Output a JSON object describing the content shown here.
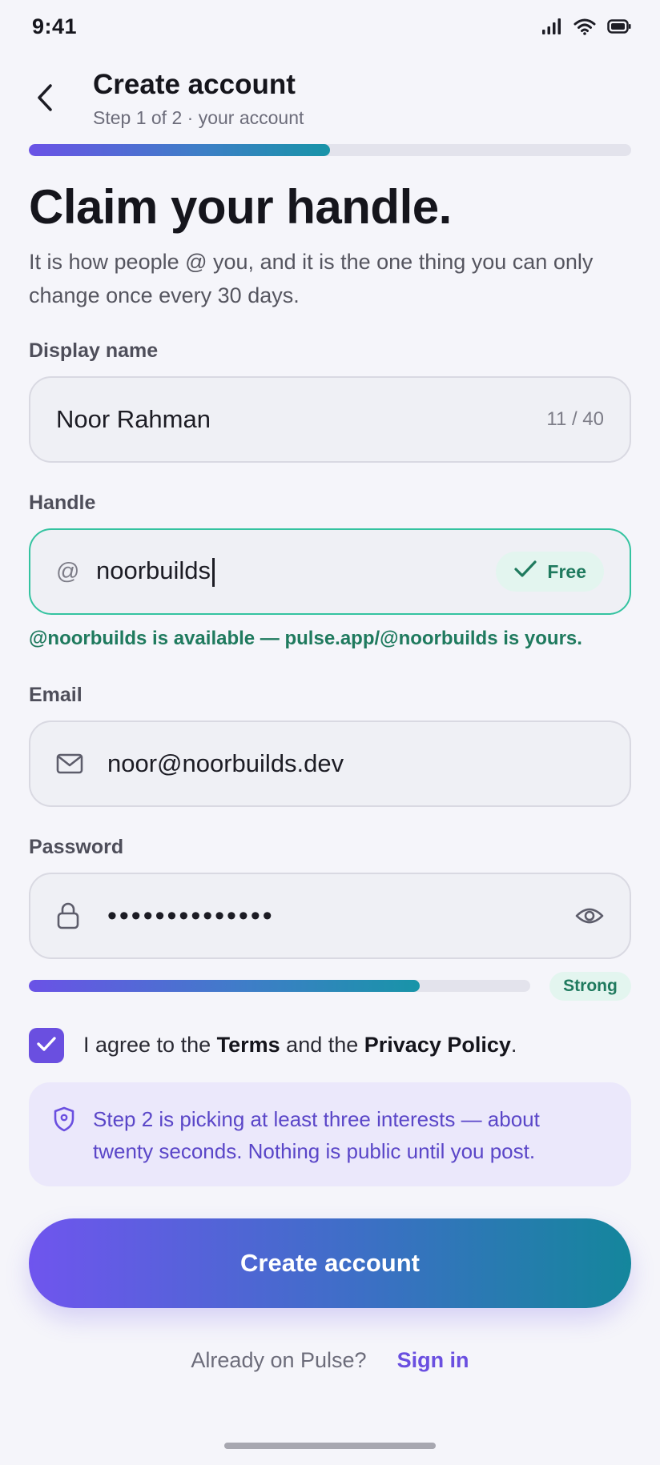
{
  "status_bar": {
    "time": "9:41"
  },
  "header": {
    "title": "Create account",
    "subtitle": "Step 1 of 2 · your account",
    "progress": 0.5
  },
  "headline": "Claim your handle.",
  "intro": "It is how people @ you, and it is the one thing you can only change once every 30 days.",
  "display_name": {
    "label": "Display name",
    "value": "Noor Rahman",
    "counter": "11 / 40"
  },
  "handle": {
    "label": "Handle",
    "prefix": "@",
    "value": "noorbuilds",
    "status": "Free",
    "message": "@noorbuilds is available — pulse.app/@noorbuilds is yours."
  },
  "email": {
    "label": "Email",
    "value": "noor@noorbuilds.dev"
  },
  "password": {
    "label": "Password",
    "masked": "••••••••••••••",
    "strength_label": "Strong",
    "strength": 0.78
  },
  "agreement": {
    "checked": true,
    "prefix": "I agree to the ",
    "terms": "Terms",
    "middle": " and the ",
    "privacy": "Privacy Policy",
    "suffix": "."
  },
  "info": {
    "text": "Step 2 is picking at least three interests — about twenty seconds. Nothing is public until you post."
  },
  "cta": {
    "label": "Create account"
  },
  "footer": {
    "question": "Already on Pulse?",
    "link": "Sign in"
  },
  "colors": {
    "accent": "#6a4fe0",
    "success": "#1f7a5e",
    "teal": "#1894a8"
  }
}
